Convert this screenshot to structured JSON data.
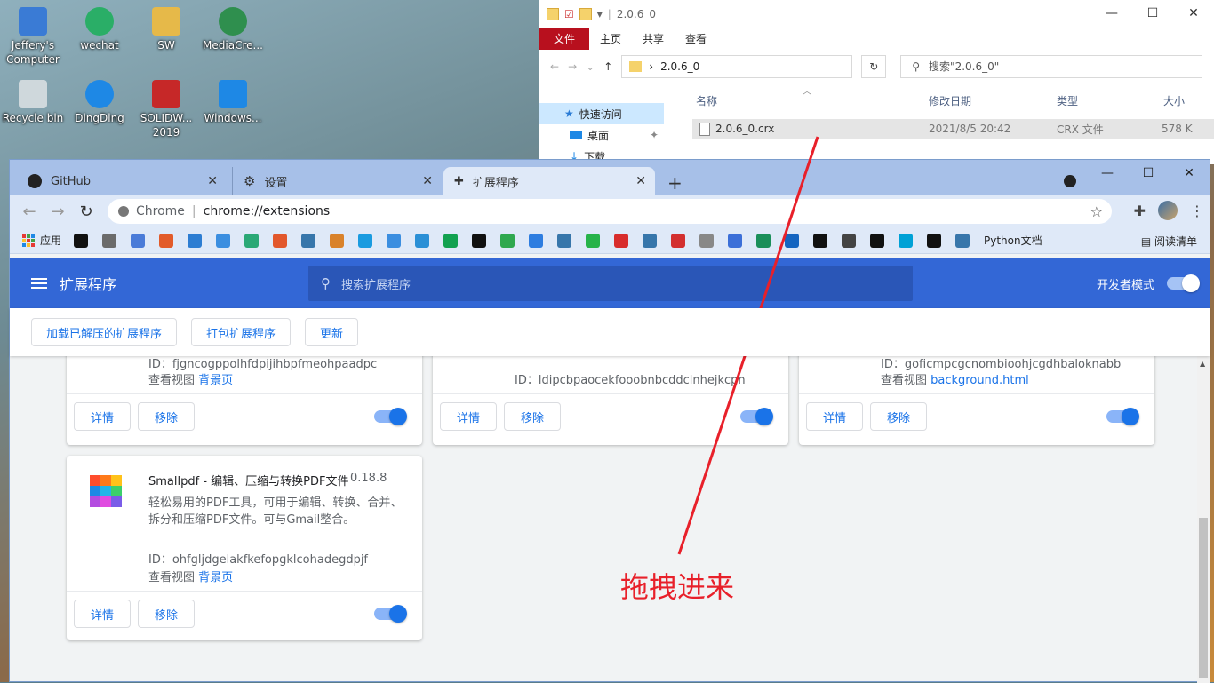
{
  "desktop": {
    "icons": [
      {
        "label": "Jeffery's Computer",
        "name": "computer-icon",
        "color": "#3a7bd5"
      },
      {
        "label": "wechat",
        "name": "wechat-icon",
        "color": "#2aae67"
      },
      {
        "label": "SW",
        "name": "sw-folder-icon",
        "color": "#e6b949"
      },
      {
        "label": "MediaCre...",
        "name": "media-creation-icon",
        "color": "#2f8f4e"
      },
      {
        "label": "Recycle bin",
        "name": "recycle-bin-icon",
        "color": "#cfd8dc"
      },
      {
        "label": "DingDing",
        "name": "dingding-icon",
        "color": "#1e88e5"
      },
      {
        "label": "SOLIDW... 2019",
        "name": "solidworks-icon",
        "color": "#c62828"
      },
      {
        "label": "Windows...",
        "name": "windows-icon",
        "color": "#1e88e5"
      }
    ]
  },
  "explorer": {
    "title": "2.0.6_0",
    "window_controls": [
      "—",
      "☐",
      "✕"
    ],
    "ribbon": {
      "file": "文件",
      "home": "主页",
      "share": "共享",
      "view": "查看"
    },
    "path": "2.0.6_0",
    "search_placeholder": "搜索\"2.0.6_0\"",
    "nav": [
      {
        "label": "快速访问",
        "selected": true
      },
      {
        "label": "桌面",
        "selected": false
      },
      {
        "label": "下载",
        "selected": false
      }
    ],
    "columns": {
      "name": "名称",
      "modified": "修改日期",
      "type": "类型",
      "size": "大小"
    },
    "file": {
      "name": "2.0.6_0.crx",
      "modified": "2021/8/5 20:42",
      "type": "CRX 文件",
      "size": "578 K"
    }
  },
  "chrome": {
    "tabs": [
      {
        "label": "GitHub",
        "icon": "github-icon",
        "active": false
      },
      {
        "label": "设置",
        "icon": "settings-gear-icon",
        "active": false
      },
      {
        "label": "扩展程序",
        "icon": "puzzle-icon",
        "active": true
      }
    ],
    "omnibox": {
      "scheme_label": "Chrome",
      "url": "chrome://extensions"
    },
    "bookmarks": {
      "apps_label": "应用",
      "python_label": "Python文档",
      "reading_list": "阅读清单",
      "icon_colors": [
        "#111111",
        "#6b6b6b",
        "#4a7bd8",
        "#e25b2a",
        "#2d7dd2",
        "#3b8ee0",
        "#2aa876",
        "#e2572c",
        "#3776ab",
        "#d9822b",
        "#1a9be0",
        "#3b8ee0",
        "#2a8fd6",
        "#12a150",
        "#111111",
        "#2fa84f",
        "#2e7de0",
        "#3776ab",
        "#27b34a",
        "#d82c2c",
        "#3776ab",
        "#d32f2f",
        "#888888",
        "#3b6fd8",
        "#1a8f5a",
        "#1565c0",
        "#111111",
        "#444444",
        "#111111",
        "#00a1d6",
        "#111111",
        "#3776ab"
      ]
    },
    "window_controls": [
      "—",
      "☐",
      "✕"
    ]
  },
  "extensions_page": {
    "title": "扩展程序",
    "search_placeholder": "搜索扩展程序",
    "dev_mode_label": "开发者模式",
    "dev_mode_on": true,
    "buttons": {
      "load_unpacked": "加载已解压的扩展程序",
      "pack": "打包扩展程序",
      "update": "更新"
    },
    "cards": [
      {
        "id": "ID：fjgncogppolhfdpijihbpfmeohpaadpc",
        "links_label": "查看视图",
        "link": "背景页",
        "details": "详情",
        "remove": "移除",
        "enabled": true
      },
      {
        "id": "ID：ldipcbpaocekfooobnbcddclnhejkcpn",
        "links_label": "",
        "link": "",
        "details": "详情",
        "remove": "移除",
        "enabled": true
      },
      {
        "id": "ID：goficmpcgcnombioohjcgdhbaloknabb",
        "links_label": "查看视图",
        "link": "background.html",
        "details": "详情",
        "remove": "移除",
        "enabled": true
      },
      {
        "name": "Smallpdf - 编辑、压缩与转换PDF文件",
        "version": "0.18.8",
        "desc_line1": "轻松易用的PDF工具，可用于编辑、转换、合并、",
        "desc_line2": "拆分和压缩PDF文件。可与Gmail整合。",
        "id": "ID：ohfgljdgelakfkefopgklcohadegdpjf",
        "links_label": "查看视图",
        "link": "背景页",
        "details": "详情",
        "remove": "移除",
        "enabled": true
      }
    ]
  },
  "annotation": {
    "text": "拖拽进来",
    "color": "#e8202a"
  }
}
